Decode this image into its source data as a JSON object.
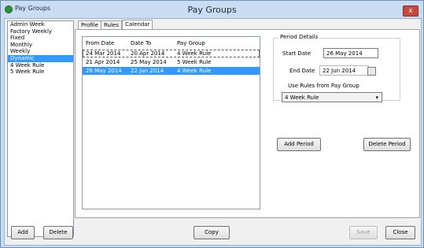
{
  "window": {
    "tab_title": "Pay Groups",
    "title": "Pay Groups",
    "close_symbol": "x"
  },
  "group_list": {
    "items": [
      "Admin Week",
      "Factory Weekly",
      "Fixed",
      "Monthly",
      "Weekly",
      "Dynamic",
      "4 Week Rule",
      "5 Week Rule"
    ],
    "selected": "Dynamic"
  },
  "tabs": [
    "Profile",
    "Rules",
    "Calendar"
  ],
  "active_tab": "Calendar",
  "calendar": {
    "headers": [
      "From Date",
      "Date To",
      "Pay Group"
    ],
    "rows": [
      [
        "24 Mar 2014",
        "20 Apr 2014",
        "4 Week Rule"
      ],
      [
        "21 Apr 2014",
        "25 May 2014",
        "5 Week Rule"
      ],
      [
        "26 May 2014",
        "22 Jun 2014",
        "4 Week Rule"
      ]
    ],
    "selected_row": 3
  },
  "period_details": {
    "legend": "Period Details",
    "start_label": "Start Date",
    "start_value": "26 May 2014",
    "end_label": "End Date",
    "end_value": "22 Jun 2014",
    "rules_label": "Use Rules from Pay Group",
    "rules_value": "4 Week Rule"
  },
  "buttons": {
    "add_period": "Add Period",
    "delete_period": "Delete Period",
    "add": "Add",
    "delete": "Delete",
    "copy": "Copy",
    "save": "Save",
    "close": "Close"
  },
  "colors": {
    "selection": "#3399ff",
    "frame": "#c9dcf1",
    "close_button": "#c74a3c"
  }
}
